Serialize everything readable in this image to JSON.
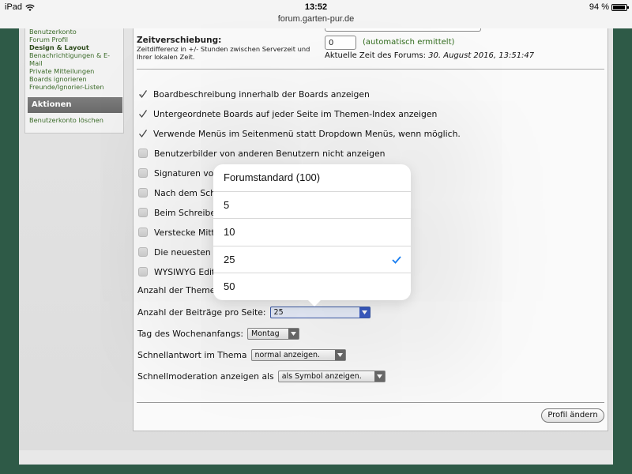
{
  "status_bar": {
    "device": "iPad",
    "time": "13:52",
    "url": "forum.garten-pur.de",
    "battery": "94 %",
    "battery_level": 0.94
  },
  "sidebar": {
    "links": [
      "Benutzerkonto",
      "Forum Profil",
      "Design & Layout",
      "Benachrichtigungen & E-",
      "Mail",
      "Private Mitteilungen",
      "Boards ignorieren",
      "Freunde/Ignorier-Listen"
    ],
    "section_title": "Aktionen",
    "actions": [
      "Benutzerkonto löschen"
    ]
  },
  "timezone": {
    "title": "Zeitverschiebung:",
    "description": "Zeitdifferenz in +/- Stunden zwischen Serverzeit und Ihrer lokalen Zeit.",
    "value": "0",
    "auto_label": "(automatisch ermittelt)",
    "current_label": "Aktuelle Zeit des Forums:",
    "current_value": "30. August 2016, 13:51:47"
  },
  "options": [
    {
      "label": "Boardbeschreibung innerhalb der Boards anzeigen",
      "checked": true
    },
    {
      "label": "Untergeordnete Boards auf jeder Seite im Themen-Index anzeigen",
      "checked": true
    },
    {
      "label": "Verwende Menüs im Seitenmenü statt Dropdown Menüs, wenn möglich.",
      "checked": true
    },
    {
      "label": "Benutzerbilder von anderen Benutzern nicht anzeigen",
      "checked": false
    },
    {
      "label": "Signaturen von",
      "checked": false
    },
    {
      "label": "Nach dem Schr",
      "checked": false
    },
    {
      "label": "Beim Schreiben",
      "checked": false
    },
    {
      "label": "Verstecke Mitte",
      "checked": false
    },
    {
      "label": "Die neuesten B",
      "checked": false
    },
    {
      "label": "WYSIWYG Edito",
      "checked": false
    }
  ],
  "fields": {
    "topics_label": "Anzahl der Themen",
    "posts_label": "Anzahl der Beiträge pro Seite:",
    "posts_value": "25",
    "week_label": "Tag des Wochenanfangs:",
    "week_value": "Montag",
    "quickreply_label": "Schnellantwort im Thema",
    "quickreply_value": "normal anzeigen.",
    "quickmod_label": "Schnellmoderation anzeigen als",
    "quickmod_value": "als Symbol anzeigen."
  },
  "popover": {
    "options": [
      "Forumstandard (100)",
      "5",
      "10",
      "25",
      "50"
    ],
    "selected": "25"
  },
  "profile_button": "Profil ändern",
  "colors": {
    "background": "#2e5a47",
    "link_green": "#3a6a28",
    "selected_check": "#1a7ef0"
  }
}
